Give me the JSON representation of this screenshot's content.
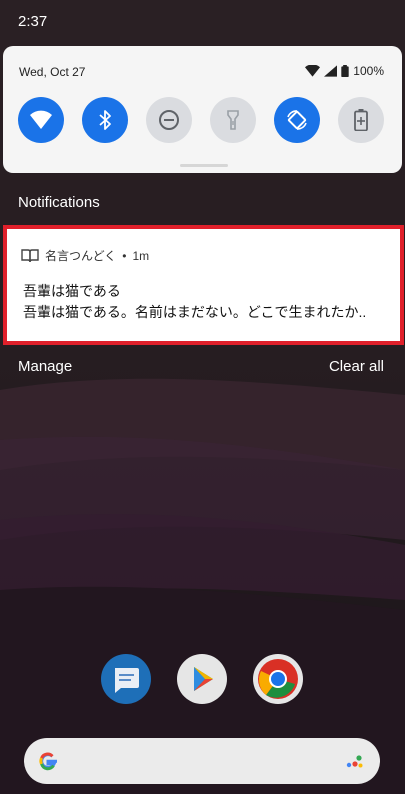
{
  "status_bar": {
    "time": "2:37"
  },
  "quick_settings": {
    "date": "Wed, Oct 27",
    "battery_percent": "100%",
    "tiles": [
      {
        "name": "wifi",
        "active": true
      },
      {
        "name": "bluetooth",
        "active": true
      },
      {
        "name": "do-not-disturb",
        "active": false
      },
      {
        "name": "flashlight",
        "active": false
      },
      {
        "name": "auto-rotate",
        "active": true
      },
      {
        "name": "battery-saver",
        "active": false
      }
    ]
  },
  "notifications": {
    "header": "Notifications",
    "items": [
      {
        "app_name": "名言つんどく",
        "time": "1m",
        "title": "吾輩は猫である",
        "text": "吾輩は猫である。名前はまだない。どこで生まれたか.."
      }
    ],
    "manage_label": "Manage",
    "clear_all_label": "Clear all"
  },
  "dock": {
    "apps": [
      "messages",
      "play-store",
      "chrome"
    ]
  },
  "colors": {
    "accent": "#1a73e8",
    "highlight_border": "#e0202b"
  }
}
